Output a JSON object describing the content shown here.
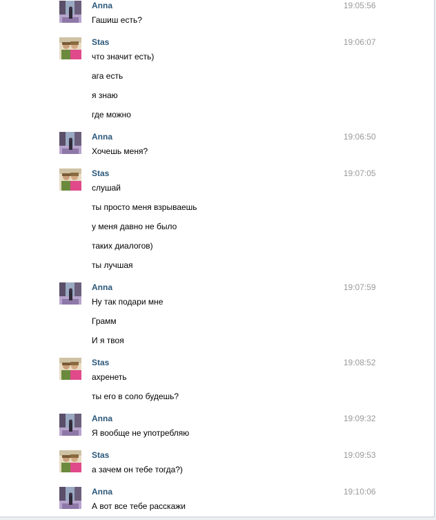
{
  "users": {
    "anna": {
      "name": "Anna",
      "avatar_icon": "anna-avatar-photo",
      "colors": [
        "#7d6a8c",
        "#b9a9c9",
        "#4d4560",
        "#9db0c8"
      ]
    },
    "stas": {
      "name": "Stas",
      "avatar_icon": "stas-avatar-photo",
      "colors": [
        "#e3d8c0",
        "#e04a8a",
        "#6b8a3d",
        "#c8a27a"
      ]
    }
  },
  "messages": [
    {
      "author": "Anna",
      "time": "19:05:56",
      "lines": [
        "Гашиш есть?"
      ]
    },
    {
      "author": "Stas",
      "time": "19:06:07",
      "lines": [
        "что значит есть)",
        "ага есть",
        "я знаю",
        "где можно"
      ]
    },
    {
      "author": "Anna",
      "time": "19:06:50",
      "lines": [
        "Хочешь меня?"
      ]
    },
    {
      "author": "Stas",
      "time": "19:07:05",
      "lines": [
        "слушай",
        "ты просто меня взрываешь",
        "у меня давно не было",
        "таких диалогов)",
        "ты лучшая"
      ]
    },
    {
      "author": "Anna",
      "time": "19:07:59",
      "lines": [
        "Ну так подари мне",
        "Грамм",
        "И я твоя"
      ]
    },
    {
      "author": "Stas",
      "time": "19:08:52",
      "lines": [
        "ахренеть",
        "ты его в соло будешь?"
      ]
    },
    {
      "author": "Anna",
      "time": "19:09:32",
      "lines": [
        "Я вообще не употребляю"
      ]
    },
    {
      "author": "Stas",
      "time": "19:09:53",
      "lines": [
        "а зачем он тебе тогда?)"
      ]
    },
    {
      "author": "Anna",
      "time": "19:10:06",
      "lines": [
        "А вот все тебе расскажи"
      ]
    }
  ]
}
